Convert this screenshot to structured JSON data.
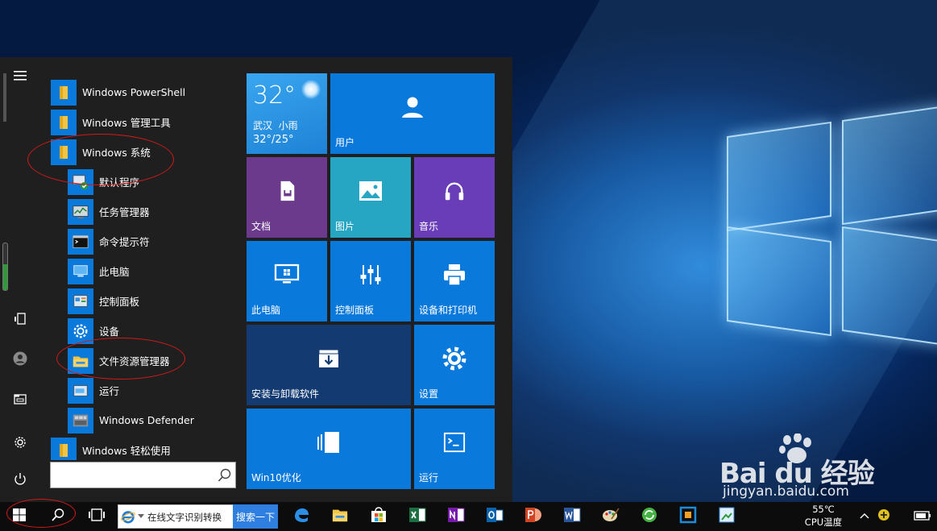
{
  "app_list": {
    "items": [
      {
        "label": "Windows PowerShell",
        "kind": "folder"
      },
      {
        "label": "Windows 管理工具",
        "kind": "folder"
      },
      {
        "label": "Windows 系统",
        "kind": "folder"
      },
      {
        "label": "默认程序",
        "kind": "app"
      },
      {
        "label": "任务管理器",
        "kind": "app"
      },
      {
        "label": "命令提示符",
        "kind": "app"
      },
      {
        "label": "此电脑",
        "kind": "app"
      },
      {
        "label": "控制面板",
        "kind": "app"
      },
      {
        "label": "设备",
        "kind": "app"
      },
      {
        "label": "文件资源管理器",
        "kind": "app"
      },
      {
        "label": "运行",
        "kind": "app"
      },
      {
        "label": "Windows Defender",
        "kind": "app"
      },
      {
        "label": "Windows 轻松使用",
        "kind": "folder"
      }
    ]
  },
  "search": {
    "value": "",
    "placeholder": ""
  },
  "weather": {
    "temp": "32°",
    "city": "武汉",
    "condition": "小雨",
    "range": "32°/25°"
  },
  "tiles": {
    "user": "用户",
    "documents": "文档",
    "pictures": "图片",
    "music": "音乐",
    "this_pc": "此电脑",
    "control_panel": "控制面板",
    "devices_printers": "设备和打印机",
    "install_uninstall": "安装与卸载软件",
    "settings": "设置",
    "win10_optimize": "Win10优化",
    "run": "运行"
  },
  "taskbar": {
    "ie_text": "在线文字识别转换",
    "search_button": "搜索一下",
    "cpu_temp": "55℃",
    "cpu_label": "CPU温度"
  },
  "watermark": {
    "brand": "Bai du 经验",
    "url": "jingyan.baidu.com"
  },
  "colors": {
    "tile_blue": "#0a79dc",
    "tile_purple": "#6b3a8c",
    "tile_teal": "#27a6c4",
    "tile_violet": "#6a3db8",
    "tile_navy": "#143a72",
    "menu_bg": "#1f1f1f",
    "annotation_red": "#d11a1a"
  }
}
